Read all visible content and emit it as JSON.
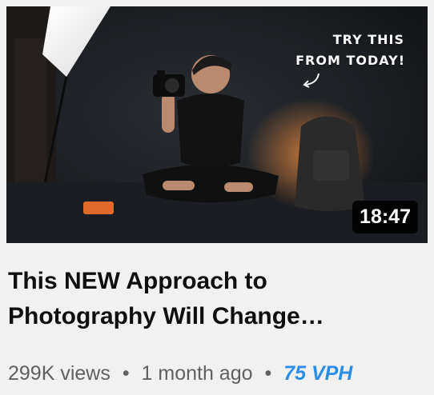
{
  "video": {
    "thumbnail": {
      "overlay_line1": "TRY THIS",
      "overlay_line2": "FROM TODAY!",
      "duration": "18:47"
    },
    "title_line1": "This NEW Approach to",
    "title_line2": "Photography Will Change…",
    "meta": {
      "views": "299K views",
      "separator": "•",
      "age": "1 month ago",
      "vph": "75 VPH"
    }
  },
  "colors": {
    "background": "#f1f1f1",
    "title": "#0f0f0f",
    "meta": "#606060",
    "vph": "#2b8de6",
    "duration_bg": "#000000"
  },
  "icons": [
    "arrow-icon"
  ]
}
